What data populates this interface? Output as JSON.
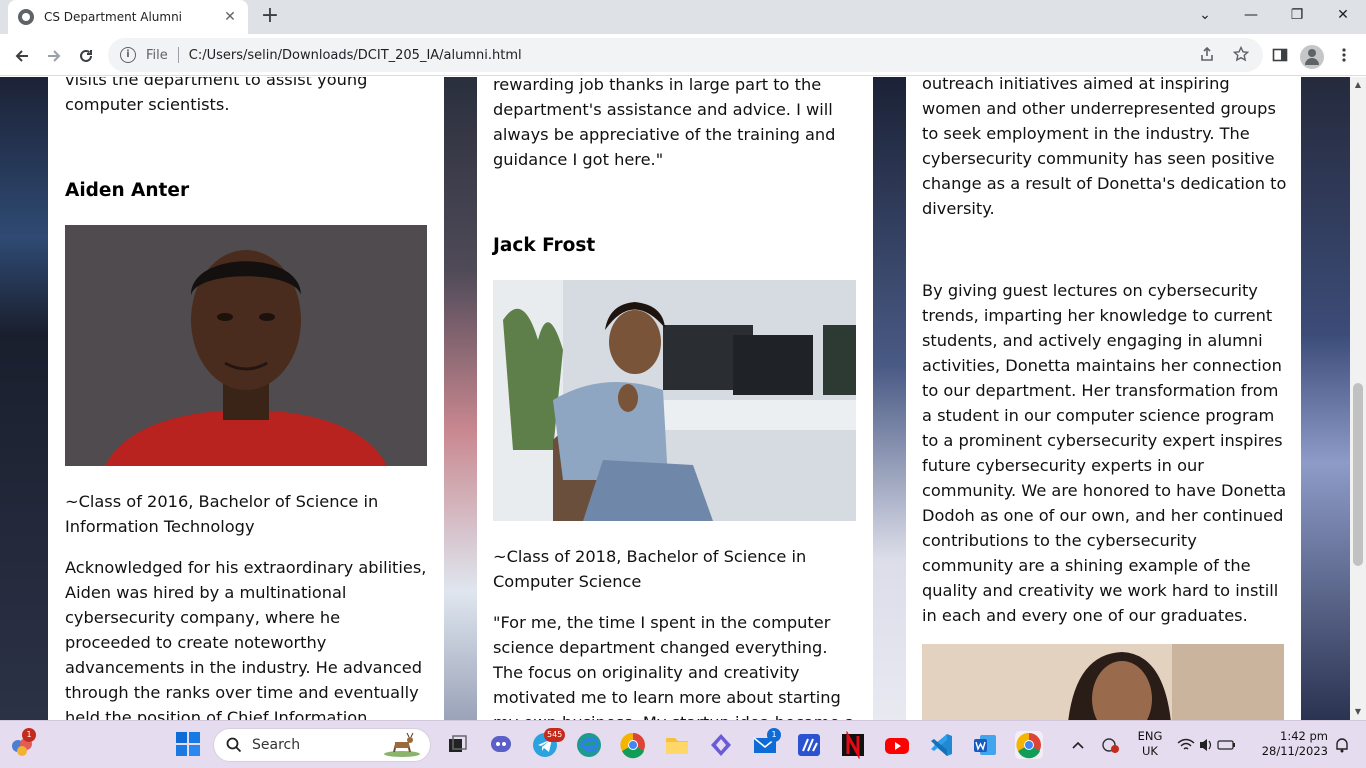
{
  "browser": {
    "tab_title": "CS Department Alumni",
    "tab_close": "✕",
    "new_tab": "+",
    "file_label": "File",
    "url": "C:/Users/selin/Downloads/DCIT_205_IA/alumni.html",
    "minimize": "—",
    "restore": "❐",
    "close": "✕",
    "chevron": "⌄"
  },
  "columns": [
    {
      "intro_lines": [
        "visits the department to assist young",
        "computer scientists."
      ],
      "name": "Aiden Anter",
      "class_lines": [
        "~Class of 2016, Bachelor of Science in",
        "Information Technology"
      ],
      "bio_lines": [
        "Acknowledged for his extraordinary abilities,",
        "Aiden was hired by a multinational",
        "cybersecurity company, where he",
        "proceeded to create noteworthy",
        "advancements in the industry. He advanced",
        "through the ranks over time and eventually",
        "held the position of Chief Information"
      ]
    },
    {
      "intro_lines": [
        "rewarding job thanks in large part to the",
        "department's assistance and advice. I will",
        "always be appreciative of the training and",
        "guidance I got here.\""
      ],
      "name": "Jack Frost",
      "class_lines": [
        "~Class of 2018, Bachelor of Science in",
        "Computer Science"
      ],
      "bio_lines": [
        "\"For me, the time I spent in the computer",
        "science department changed everything.",
        "The focus on originality and creativity",
        "motivated me to learn more about starting",
        "my own business. My startup idea became a"
      ]
    },
    {
      "intro_lines": [
        "outreach initiatives aimed at inspiring",
        "women and other underrepresented groups",
        "to seek employment in the industry. The",
        "cybersecurity community has seen positive",
        "change as a result of Donetta's dedication to",
        "diversity."
      ],
      "bio_lines": [
        "By giving guest lectures on cybersecurity",
        "trends, imparting her knowledge to current",
        "students, and actively engaging in alumni",
        "activities, Donetta maintains her connection",
        "to our department. Her transformation from",
        "a student in our computer science program",
        "to a prominent cybersecurity expert inspires",
        "future cybersecurity experts in our",
        "community. We are honored to have Donetta",
        "Dodoh as one of our own, and her continued",
        "contributions to the cybersecurity",
        "community are a shining example of the",
        "quality and creativity we work hard to instill",
        "in each and every one of our graduates."
      ]
    }
  ],
  "taskbar": {
    "search_label": "Search",
    "widget_badge": "1",
    "telegram_badge": "545",
    "mail_badge": "1",
    "lang_1": "ENG",
    "lang_2": "UK",
    "time": "1:42 pm",
    "date": "28/11/2023"
  },
  "colors": {
    "chrome_tabstrip": "#dee1e6",
    "taskbar_bg": "#e6dcef",
    "card_bg": "#ffffff",
    "text": "#111111"
  },
  "icons": [
    "globe-icon",
    "back-arrow-icon",
    "forward-arrow-icon",
    "reload-icon",
    "info-icon",
    "share-icon",
    "star-icon",
    "sidebar-icon",
    "profile-icon",
    "more-vert-icon",
    "windows-start-icon",
    "search-icon"
  ]
}
